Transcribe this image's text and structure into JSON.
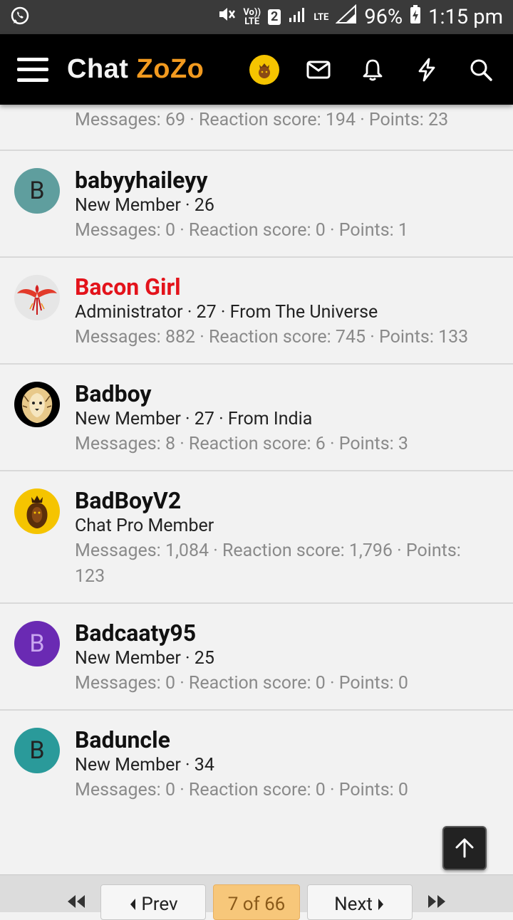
{
  "status_bar": {
    "volte_top": "Vo))",
    "volte_bottom": "LTE",
    "sim": "2",
    "network": "LTE",
    "battery": "96%",
    "time": "1:15 pm"
  },
  "header": {
    "logo_chat": "Chat",
    "logo_zozo": "ZoZo"
  },
  "members": [
    {
      "partial": true,
      "stats": "Messages: 69 · Reaction score: 194 · Points: 23"
    },
    {
      "initial": "B",
      "avatar_color": "#5f9e9e",
      "name": "babyyhaileyy",
      "title": "New Member · 26",
      "stats": "Messages: 0 · Reaction score: 0 · Points: 1"
    },
    {
      "avatar_icon": "phoenix",
      "name": "Bacon Girl",
      "name_color": "#e3131b",
      "title": "Administrator · 27 · From The Universe",
      "stats": "Messages: 882 · Reaction score: 745 · Points: 133"
    },
    {
      "avatar_icon": "lion-dark",
      "name": "Badboy",
      "title": "New Member · 27 · From India",
      "stats": "Messages: 8 · Reaction score: 6 · Points: 3"
    },
    {
      "avatar_icon": "lion-gold",
      "name": "BadBoyV2",
      "title": "Chat Pro Member",
      "stats": "Messages: 1,084 · Reaction score: 1,796 · Points: 123"
    },
    {
      "initial": "B",
      "avatar_color": "#6a2ab3",
      "initial_color": "#c9a6f0",
      "name": "Badcaaty95",
      "title": "New Member · 25",
      "stats": "Messages: 0 · Reaction score: 0 · Points: 0"
    },
    {
      "initial": "B",
      "avatar_color": "#2a9a9a",
      "name": "Baduncle",
      "title": "New Member · 34",
      "stats": "Messages: 0 · Reaction score: 0 · Points: 0"
    }
  ],
  "pagination": {
    "prev_label": "Prev",
    "current_label": "7 of 66",
    "next_label": "Next"
  }
}
